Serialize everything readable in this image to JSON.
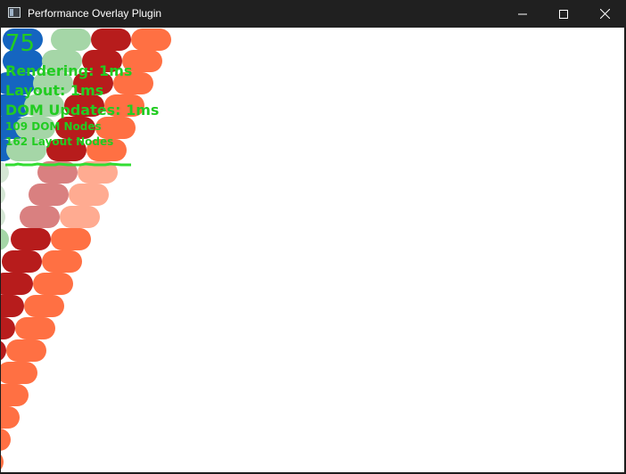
{
  "window": {
    "title": "Performance Overlay Plugin",
    "icon": "app-window-icon",
    "controls": [
      "minimize-icon",
      "maximize-icon",
      "close-icon"
    ]
  },
  "overlay": {
    "fps": "75",
    "rendering": "Rendering: 1ms",
    "layout": "Layout: 1ms",
    "dom_updates": "DOM Updates: 1ms",
    "dom_nodes": "109 DOM Nodes",
    "layout_nodes": "162 Layout Nodes"
  },
  "colors": {
    "overlay_text": "#22cc22",
    "graph_line": "#33dd33",
    "blue": "#1565c0",
    "green": "#a5d6a7",
    "red": "#b71c1c",
    "orange": "#ff7043",
    "light_red": "#d98080",
    "light_orange": "#ffab91",
    "light_green": "#d4e6d4"
  }
}
